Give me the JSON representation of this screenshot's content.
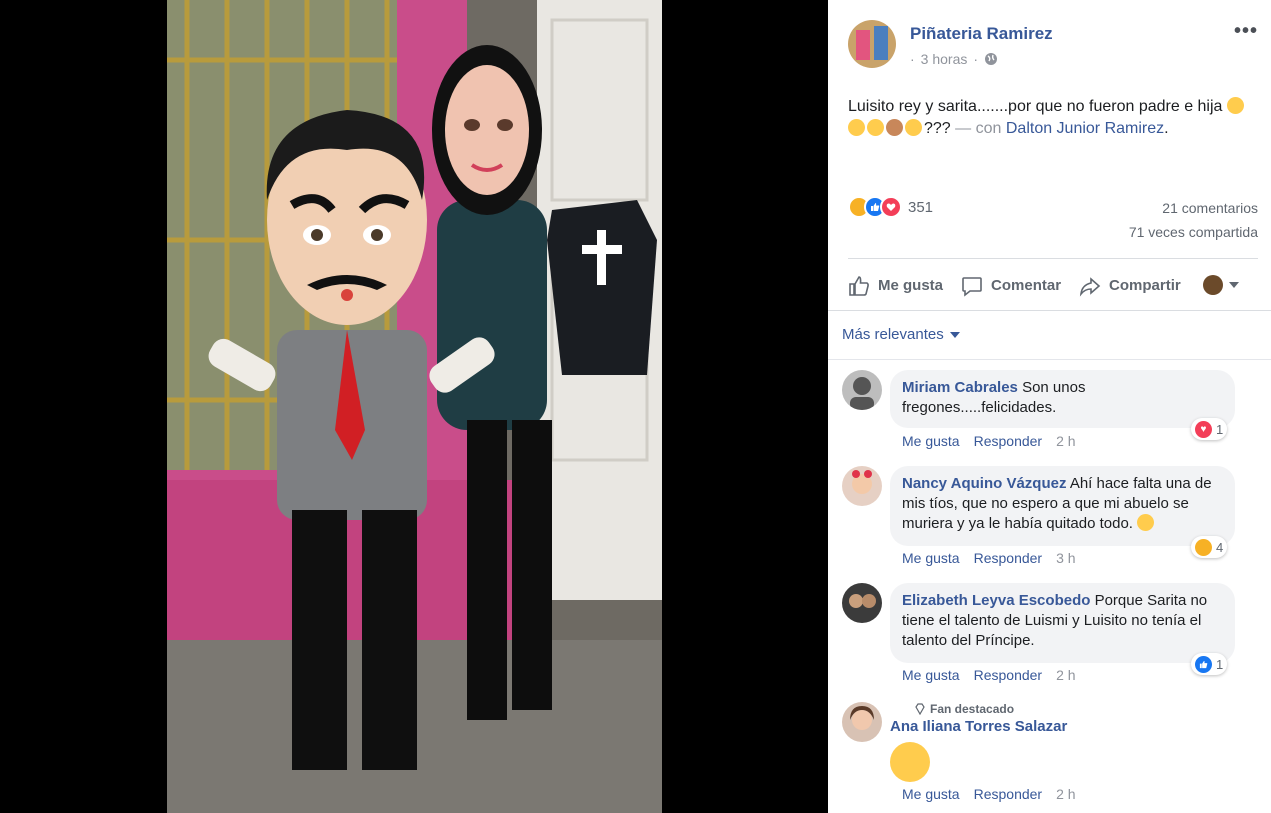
{
  "post": {
    "page_name": "Piñateria Ramirez",
    "time": "3 horas",
    "privacy_icon": "globe-icon",
    "more_label": "•••",
    "text_main": "Luisito rey y sarita.......por que no fueron padre e hija",
    "text_tail": "???",
    "with_label": "— con",
    "tagged": "Dalton Junior Ramirez",
    "period": "."
  },
  "stats": {
    "reactions_count": "351",
    "comments": "21 comentarios",
    "shares": "71 veces compartida"
  },
  "actions": {
    "like": "Me gusta",
    "comment": "Comentar",
    "share": "Compartir"
  },
  "sort_label": "Más relevantes",
  "comments": [
    {
      "name": "Miriam Cabrales",
      "text": "Son unos fregones.....felicidades.",
      "like": "Me gusta",
      "reply": "Responder",
      "time": "2 h",
      "reaction_count": "1"
    },
    {
      "name": "Nancy Aquino Vázquez",
      "text": "Ahí hace falta una de mis tíos, que no espero a que mi abuelo se muriera y ya le había quitado todo.",
      "like": "Me gusta",
      "reply": "Responder",
      "time": "3 h",
      "reaction_count": "4"
    },
    {
      "name": "Elizabeth Leyva Escobedo",
      "text": "Porque Sarita no tiene el talento de Luismi y Luisito no tenía el talento del Príncipe.",
      "like": "Me gusta",
      "reply": "Responder",
      "time": "2 h",
      "reaction_count": "1"
    },
    {
      "badge": "Fan destacado",
      "name": "Ana Iliana Torres Salazar",
      "like": "Me gusta",
      "reply": "Responder",
      "time": "2 h"
    }
  ],
  "colors": {
    "link": "#385898",
    "muted": "#90949c",
    "bubble": "#f2f3f5"
  }
}
